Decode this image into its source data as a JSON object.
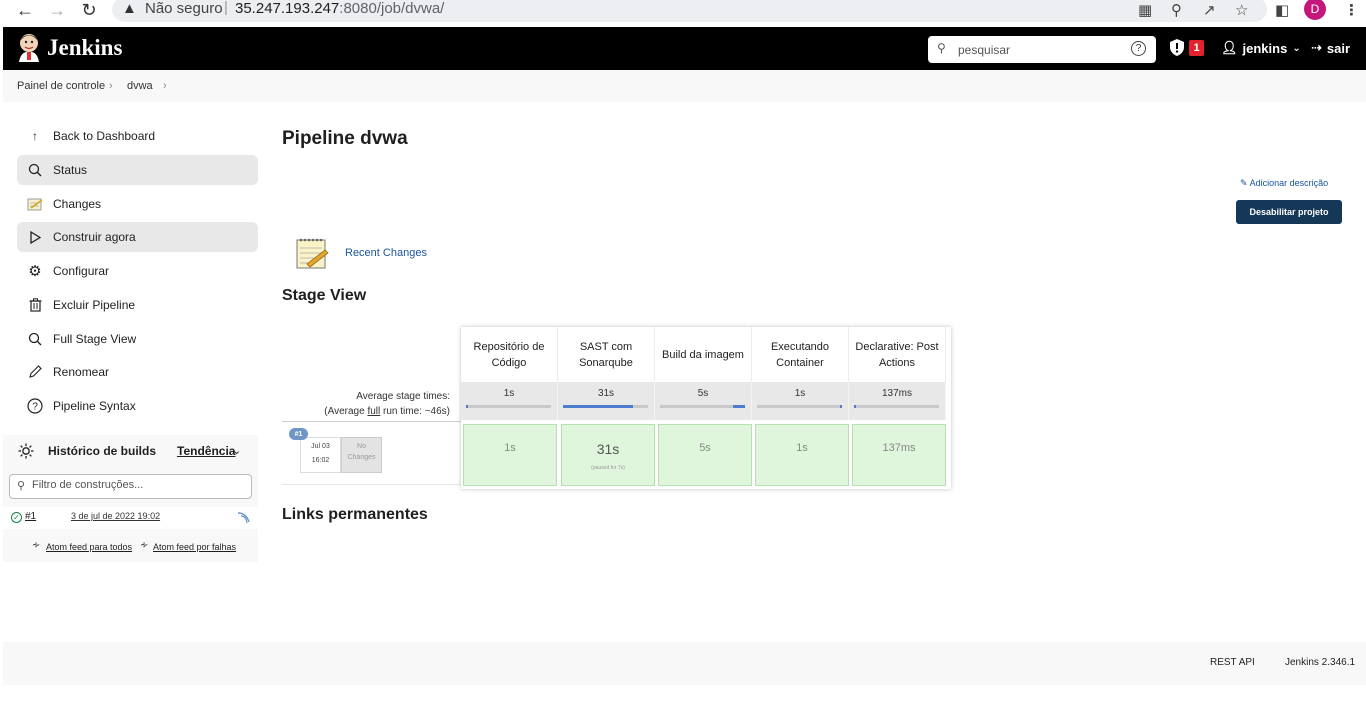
{
  "browser": {
    "security_label": "Não seguro",
    "url_host": "35.247.193.247",
    "url_rest": ":8080/job/dvwa/",
    "profile_initial": "D"
  },
  "header": {
    "brand": "Jenkins",
    "search_placeholder": "pesquisar",
    "alert_count": "1",
    "user": "jenkins",
    "logout": "sair"
  },
  "breadcrumb": [
    "Painel de controle",
    "dvwa"
  ],
  "sidebar": {
    "items": [
      {
        "label": "Back to Dashboard",
        "icon": "arrow-up-icon"
      },
      {
        "label": "Status",
        "icon": "search-icon"
      },
      {
        "label": "Changes",
        "icon": "notepad-icon"
      },
      {
        "label": "Construir agora",
        "icon": "play-icon"
      },
      {
        "label": "Configurar",
        "icon": "gear-icon"
      },
      {
        "label": "Excluir Pipeline",
        "icon": "trash-icon"
      },
      {
        "label": "Full Stage View",
        "icon": "search-icon"
      },
      {
        "label": "Renomear",
        "icon": "pencil-icon"
      },
      {
        "label": "Pipeline Syntax",
        "icon": "help-icon"
      }
    ],
    "build_history": {
      "title": "Histórico de builds",
      "trend": "Tendência",
      "filter_placeholder": "Filtro de construções...",
      "builds": [
        {
          "number": "#1",
          "date": "3 de jul de 2022 19:02"
        }
      ],
      "feed_all": "Atom feed para todos",
      "feed_failures": "Atom feed por falhas"
    }
  },
  "main": {
    "title": "Pipeline dvwa",
    "add_description": "Adicionar descrição",
    "disable_button": "Desabilitar projeto",
    "recent_changes": "Recent Changes",
    "stage_view_title": "Stage View",
    "links_title": "Links permanentes",
    "avg_label_line1": "Average stage times:",
    "avg_label_prefix": "(Average ",
    "avg_label_full": "full",
    "avg_label_suffix": " run time: ~46s)",
    "stages": [
      {
        "name": "Repositório de Código",
        "avg": "1s",
        "avg_progress": 0.02,
        "cell": "1s"
      },
      {
        "name": "SAST com Sonarqube",
        "avg": "31s",
        "avg_progress": 0.82,
        "cell": "31s",
        "cell_note": "(paused for 7s)"
      },
      {
        "name": "Build da imagem",
        "avg": "5s",
        "avg_progress": 0.14,
        "cell": "5s"
      },
      {
        "name": "Executando Container",
        "avg": "1s",
        "avg_progress": 0.02,
        "cell": "1s"
      },
      {
        "name": "Declarative: Post Actions",
        "avg": "137ms",
        "avg_progress": 0.0,
        "cell": "137ms"
      }
    ],
    "run": {
      "badge": "#1",
      "date": "Jul 03",
      "time": "16:02",
      "changes_line1": "No",
      "changes_line2": "Changes"
    }
  },
  "footer": {
    "rest_api": "REST API",
    "version": "Jenkins 2.346.1"
  },
  "colors": {
    "header_bg": "#000000",
    "alert_badge": "#e2222f",
    "primary_button": "#163858",
    "stage_success": "#dff6dc",
    "progress": "#4c7dcf",
    "link": "#1a55a0"
  }
}
